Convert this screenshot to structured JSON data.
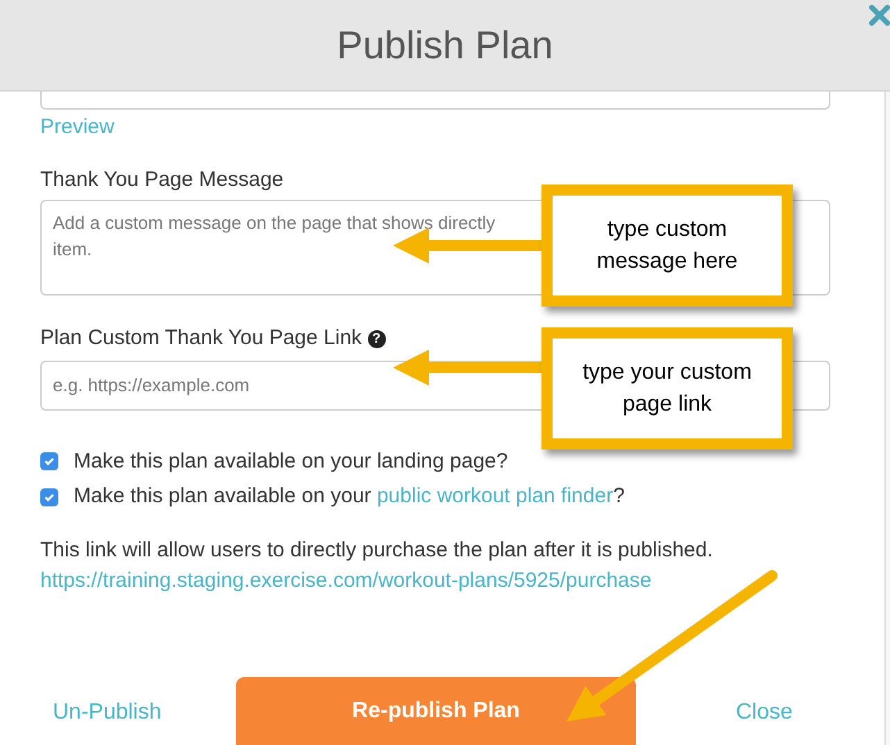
{
  "modal": {
    "title": "Publish Plan"
  },
  "preview_link": "Preview",
  "message_field": {
    "label": "Thank You Page Message",
    "placeholder": "Add a custom message on the page that shows directly\nitem."
  },
  "link_field": {
    "label": "Plan Custom Thank You Page Link",
    "help_icon": "?",
    "placeholder": "e.g. https://example.com"
  },
  "options": [
    {
      "text": "Make this plan available on your landing page?",
      "checked": true
    },
    {
      "text": "Make this plan available on your ",
      "link": "public workout plan finder",
      "after": "?",
      "checked": true
    }
  ],
  "purchase_note": "This link will allow users to directly purchase the plan after it is published.",
  "purchase_url": "https://training.staging.exercise.com/workout-plans/5925/purchase",
  "footer": {
    "unpublish": "Un-Publish",
    "republish": "Re-publish Plan",
    "close": "Close"
  },
  "callouts": [
    "type custom message here",
    "type your custom page link"
  ]
}
